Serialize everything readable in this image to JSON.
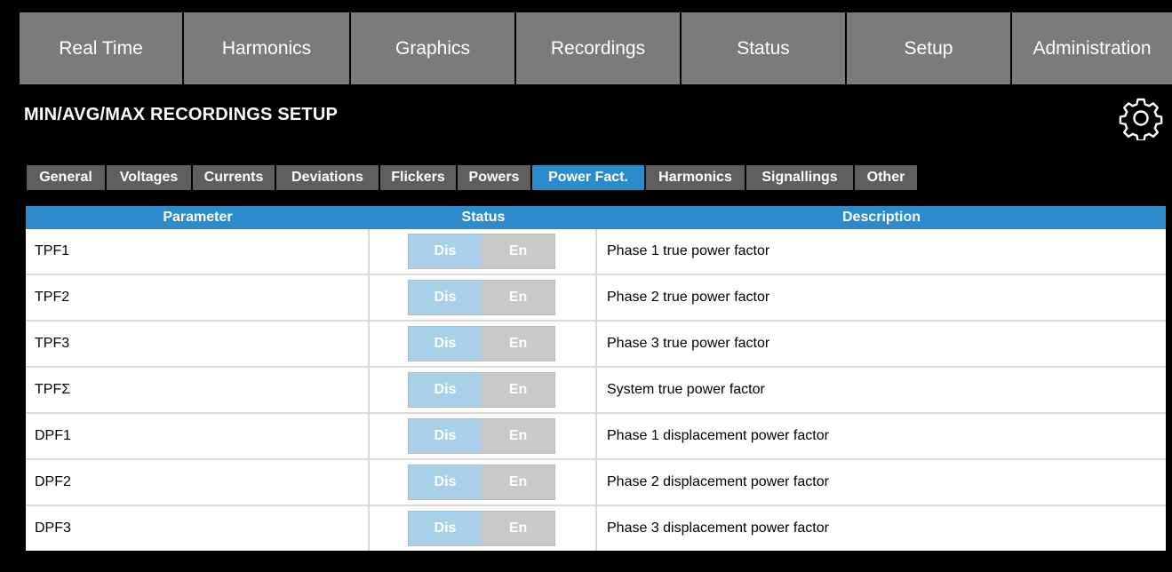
{
  "topnav": [
    {
      "label": "Real Time"
    },
    {
      "label": "Harmonics"
    },
    {
      "label": "Graphics"
    },
    {
      "label": "Recordings"
    },
    {
      "label": "Status"
    },
    {
      "label": "Setup"
    },
    {
      "label": "Administration"
    }
  ],
  "page": {
    "title": "MIN/AVG/MAX RECORDINGS SETUP",
    "settings_icon": "gear-icon"
  },
  "subtabs": [
    {
      "label": "General"
    },
    {
      "label": "Voltages"
    },
    {
      "label": "Currents"
    },
    {
      "label": "Deviations"
    },
    {
      "label": "Flickers"
    },
    {
      "label": "Powers"
    },
    {
      "label": "Power Fact.",
      "active": true
    },
    {
      "label": "Harmonics"
    },
    {
      "label": "Signallings"
    },
    {
      "label": "Other"
    }
  ],
  "table": {
    "headers": {
      "parameter": "Parameter",
      "status": "Status",
      "description": "Description"
    },
    "rows": [
      {
        "parameter": "TPF1",
        "dis": "Dis",
        "en": "En",
        "description": "Phase 1 true power factor"
      },
      {
        "parameter": "TPF2",
        "dis": "Dis",
        "en": "En",
        "description": "Phase 2 true power factor"
      },
      {
        "parameter": "TPF3",
        "dis": "Dis",
        "en": "En",
        "description": "Phase 3 true power factor"
      },
      {
        "parameter": "TPFΣ",
        "dis": "Dis",
        "en": "En",
        "description": "System true power factor"
      },
      {
        "parameter": "DPF1",
        "dis": "Dis",
        "en": "En",
        "description": "Phase 1 displacement power factor"
      },
      {
        "parameter": "DPF2",
        "dis": "Dis",
        "en": "En",
        "description": "Phase 2 displacement power factor"
      },
      {
        "parameter": "DPF3",
        "dis": "Dis",
        "en": "En",
        "description": "Phase 3 displacement power factor"
      }
    ]
  },
  "colors": {
    "nav_bg": "#7b7b7b",
    "subtab_bg": "#5e5e5e",
    "accent": "#2b8bcc",
    "toggle_dis": "#a9d0e9",
    "toggle_en": "#c9c9c9"
  }
}
